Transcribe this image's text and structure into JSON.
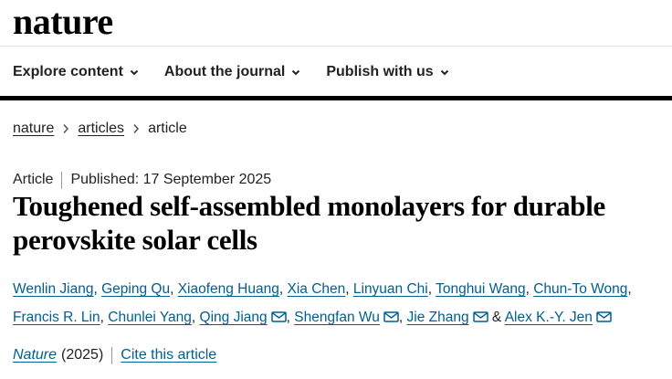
{
  "brand": {
    "logo_text": "nature"
  },
  "nav": [
    {
      "label": "Explore content"
    },
    {
      "label": "About the journal"
    },
    {
      "label": "Publish with us"
    }
  ],
  "breadcrumb": [
    {
      "label": "nature"
    },
    {
      "label": "articles"
    },
    {
      "label": "article"
    }
  ],
  "article": {
    "type": "Article",
    "published": "Published: 17 September 2025",
    "title": "Toughened self-assembled monolayers for durable perovskite solar cells",
    "authors_line1": [
      {
        "name": "Wenlin Jiang",
        "sep": ", "
      },
      {
        "name": "Geping Qu",
        "sep": ", "
      },
      {
        "name": "Xiaofeng Huang",
        "sep": ", "
      },
      {
        "name": "Xia Chen",
        "sep": ", "
      },
      {
        "name": "Linyuan Chi",
        "sep": ", "
      },
      {
        "name": "Tonghui Wang",
        "sep": ", "
      },
      {
        "name": "Chun-To Wong",
        "sep": ","
      }
    ],
    "authors_line2": [
      {
        "name": "Francis R. Lin",
        "sep": ", "
      },
      {
        "name": "Chunlei Yang",
        "sep": ", "
      },
      {
        "name": "Qing Jiang",
        "sep": ", "
      },
      {
        "name": "Shengfan Wu",
        "sep": ", "
      },
      {
        "name": "Jie Zhang",
        "sep": " & "
      },
      {
        "name": "Alex K.-Y. Jen",
        "sep": ""
      }
    ],
    "journal": "Nature",
    "year": "(2025)",
    "cite_label": "Cite this article"
  },
  "icons": {
    "chevron": "chevron-down-icon",
    "separator": "chevron-right-icon",
    "mail": "envelope-icon"
  },
  "colors": {
    "link": "#025e8d",
    "text": "#222222",
    "rule": "#000000"
  }
}
